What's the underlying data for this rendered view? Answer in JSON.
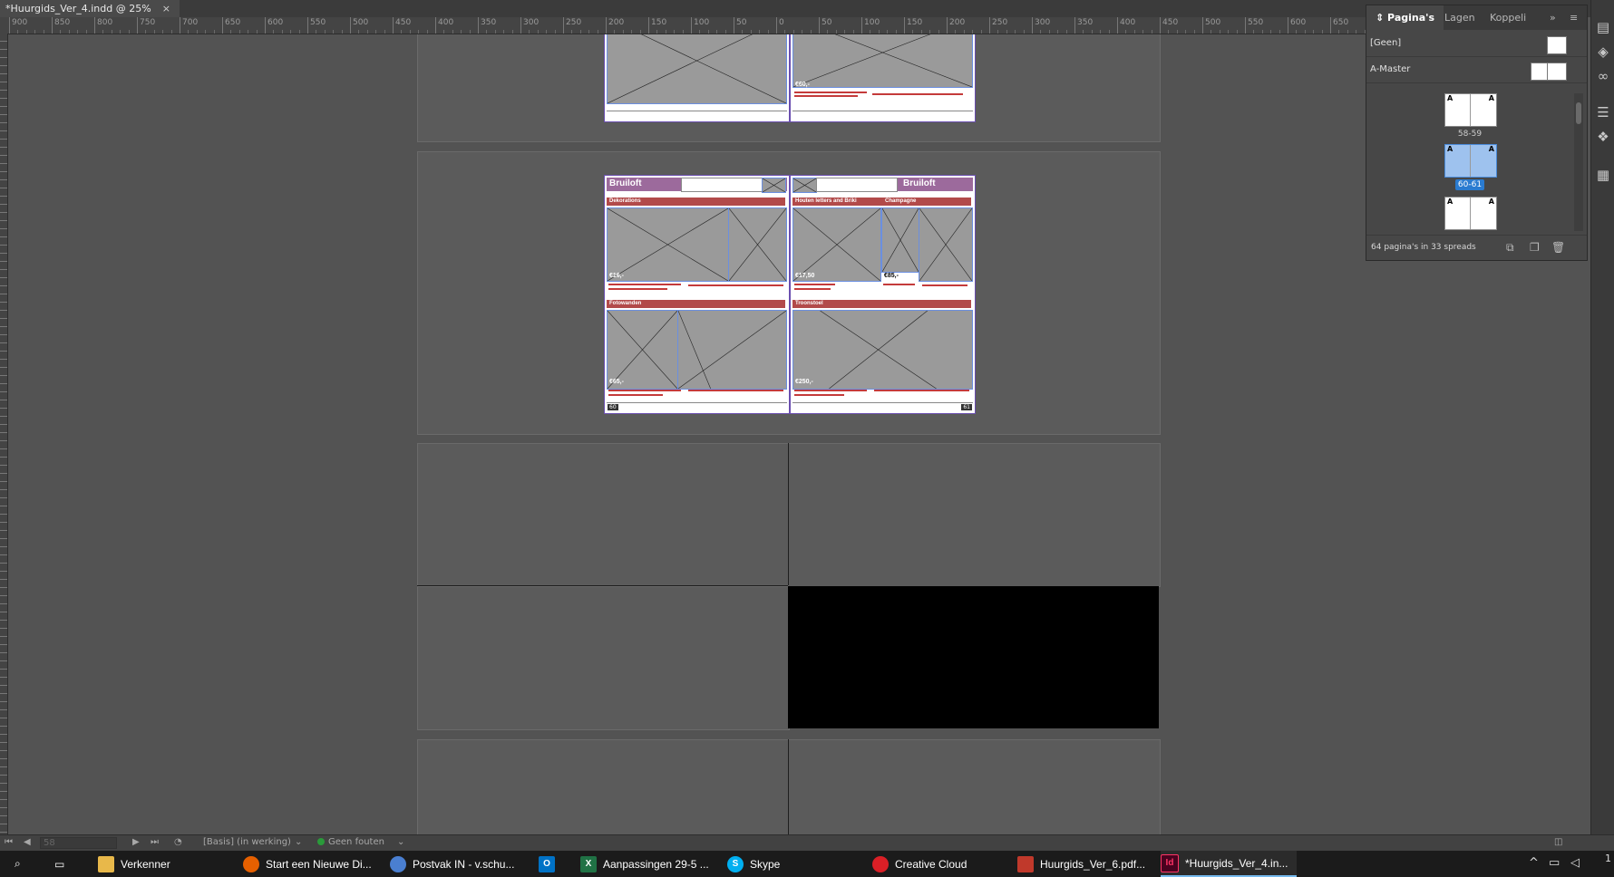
{
  "document_tab": {
    "title": "*Huurgids_Ver_4.indd @ 25%",
    "close": "×"
  },
  "ruler_labels": [
    "900",
    "850",
    "800",
    "750",
    "700",
    "650",
    "600",
    "550",
    "500",
    "450",
    "400",
    "350",
    "300",
    "250",
    "200",
    "150",
    "100",
    "50",
    "0",
    "50",
    "100",
    "150",
    "200",
    "250",
    "300",
    "350",
    "400",
    "450",
    "500",
    "550",
    "600",
    "650"
  ],
  "spread_top": {
    "price": "€60,-"
  },
  "spread_main": {
    "left_header": "Bruiloft",
    "right_header": "Bruiloft",
    "sections": {
      "top_left": "Dekorations",
      "top_mid": "Houten letters and Briki",
      "top_right": "Champagne",
      "bottom_left": "Fotowanden",
      "bottom_right": "Troonstoel"
    },
    "prices": {
      "top_left": "€16,-",
      "top_mid": "€17,50",
      "top_right": "€85,-",
      "bottom_left": "€65,-",
      "bottom_right": "€250,-"
    },
    "page_numbers": {
      "left": "60",
      "right": "61"
    }
  },
  "status_bar": {
    "page_field": "58",
    "master": "[Basis] (in werking)",
    "preflight": "Geen fouten"
  },
  "pages_panel": {
    "tabs": [
      "Pagina's",
      "Lagen",
      "Koppeli"
    ],
    "expand": "»",
    "menu": "≡",
    "masters": [
      {
        "name": "[Geen]"
      },
      {
        "name": "A-Master"
      }
    ],
    "spreads": [
      {
        "label": "58-59",
        "selected": false
      },
      {
        "label": "60-61",
        "selected": true
      },
      {
        "label": "",
        "selected": false
      }
    ],
    "page_master_letter": "A",
    "summary": "64 pagina's in 33 spreads"
  },
  "taskbar": {
    "apps": [
      {
        "label": "Verkenner",
        "color": "#e8b84a"
      },
      {
        "label": "Start een Nieuwe Di...",
        "color": "#e66000"
      },
      {
        "label": "Postvak IN - v.schu...",
        "color": "#4a7fd1"
      },
      {
        "label": "",
        "color": "#0072c6"
      },
      {
        "label": "Aanpassingen 29-5 ...",
        "color": "#207245"
      },
      {
        "label": "Skype",
        "color": "#00aff0"
      },
      {
        "label": "Creative Cloud",
        "color": "#da1f26"
      },
      {
        "label": "Huurgids_Ver_6.pdf...",
        "color": "#c0392b"
      },
      {
        "label": "*Huurgids_Ver_4.in...",
        "color": "#ff3366"
      }
    ],
    "clock": "1"
  }
}
